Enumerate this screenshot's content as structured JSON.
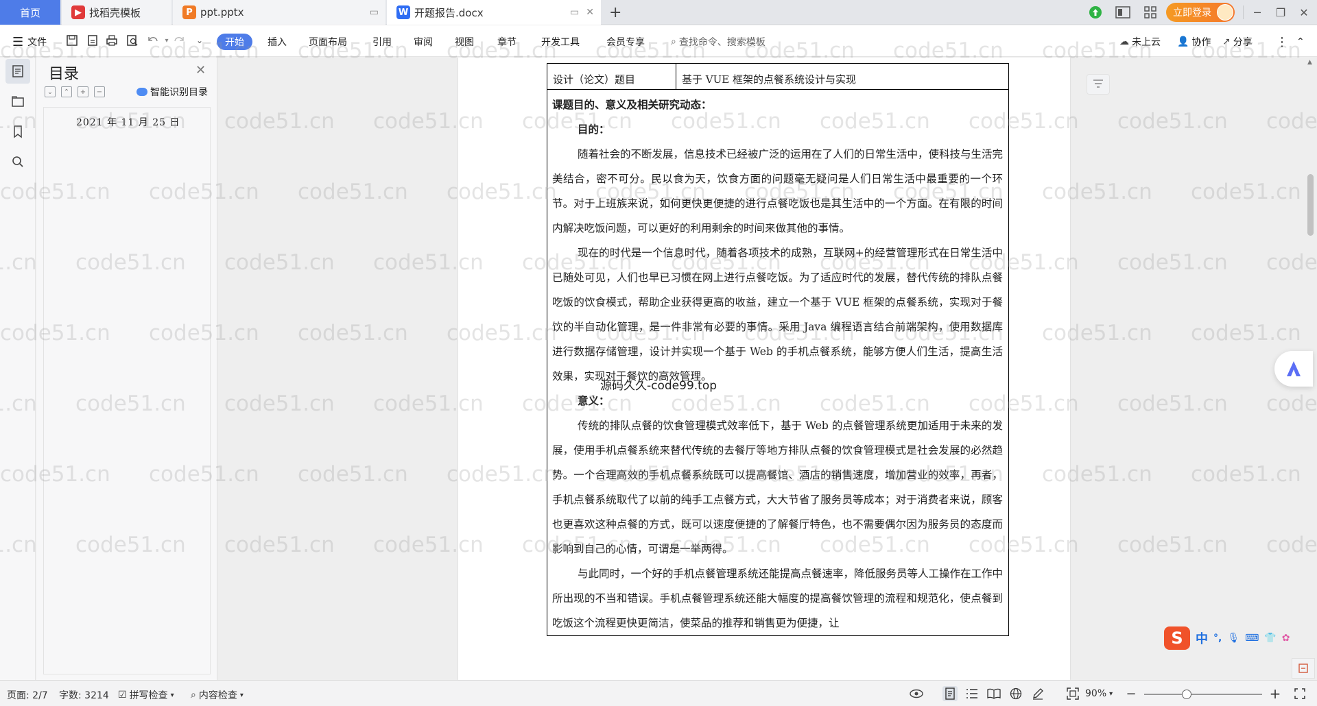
{
  "tabs": {
    "home": "首页",
    "items": [
      {
        "label": "找稻壳模板",
        "icon": "docer-icon",
        "color": "#e03a3a"
      },
      {
        "label": "ppt.pptx",
        "icon": "ppt-icon",
        "color": "#f07a25"
      },
      {
        "label": "开题报告.docx",
        "icon": "wps-writer-icon",
        "color": "#2f6df3"
      }
    ],
    "new_tab": "+",
    "login": "立即登录"
  },
  "ribbon": {
    "file": "文件",
    "menus": [
      "开始",
      "插入",
      "页面布局",
      "引用",
      "审阅",
      "视图",
      "章节",
      "开发工具",
      "会员专享"
    ],
    "search_placeholder": "查找命令、搜索模板",
    "cloud": "未上云",
    "collab": "协作",
    "share": "分享"
  },
  "toc": {
    "title": "目录",
    "smart": "智能识别目录",
    "date": "2021 年 11 月 25 日"
  },
  "document": {
    "title_label": "设计（论文）题目",
    "title_value": "基于 VUE 框架的点餐系统设计与实现",
    "section_heading": "课题目的、意义及相关研究动态：",
    "purpose_heading": "目的：",
    "purpose_paragraphs": [
      "随着社会的不断发展，信息技术已经被广泛的运用在了人们的日常生活中，使科技与生活完美结合，密不可分。民以食为天，饮食方面的问题毫无疑问是人们日常生活中最重要的一个环节。对于上班族来说，如何更快更便捷的进行点餐吃饭也是其生活中的一个方面。在有限的时间内解决吃饭问题，可以更好的利用剩余的时间来做其他的事情。",
      "现在的时代是一个信息时代，随着各项技术的成熟，互联网+的经营管理形式在日常生活中已随处可见，人们也早已习惯在网上进行点餐吃饭。为了适应时代的发展，替代传统的排队点餐吃饭的饮食模式，帮助企业获得更高的收益，建立一个基于 VUE 框架的点餐系统，实现对于餐饮的半自动化管理，是一件非常有必要的事情。采用 Java 编程语言结合前端架构，使用数据库进行数据存储管理，设计并实现一个基于 Web 的手机点餐系统，能够方便人们生活，提高生活效果，实现对于餐饮的高效管理。"
    ],
    "meaning_heading": "意义：",
    "meaning_paragraphs": [
      "传统的排队点餐的饮食管理模式效率低下，基于 Web 的点餐管理系统更加适用于未来的发展，使用手机点餐系统来替代传统的去餐厅等地方排队点餐的饮食管理模式是社会发展的必然趋势。一个合理高效的手机点餐系统既可以提高餐馆、酒店的销售速度，增加营业的效率，再者，手机点餐系统取代了以前的纯手工点餐方式，大大节省了服务员等成本；对于消费者来说，顾客也更喜欢这种点餐的方式，既可以速度便捷的了解餐厅特色，也不需要偶尔因为服务员的态度而影响到自己的心情，可谓是一举两得。",
      "与此同时，一个好的手机点餐管理系统还能提高点餐速率，降低服务员等人工操作在工作中所出现的不当和错误。手机点餐管理系统还能大幅度的提高餐饮管理的流程和规范化，使点餐到吃饭这个流程更快更简洁，使菜品的推荐和销售更为便捷，让"
    ]
  },
  "watermark": {
    "text": "code51.cn",
    "overlay": "源码久久-code99.top"
  },
  "ime": {
    "lang": "中",
    "punct": "°,"
  },
  "status": {
    "page": "页面: 2/7",
    "words": "字数: 3214",
    "spell": "拼写检查",
    "content_check": "内容检查",
    "zoom": "90%",
    "zoom_level": 0.36
  }
}
